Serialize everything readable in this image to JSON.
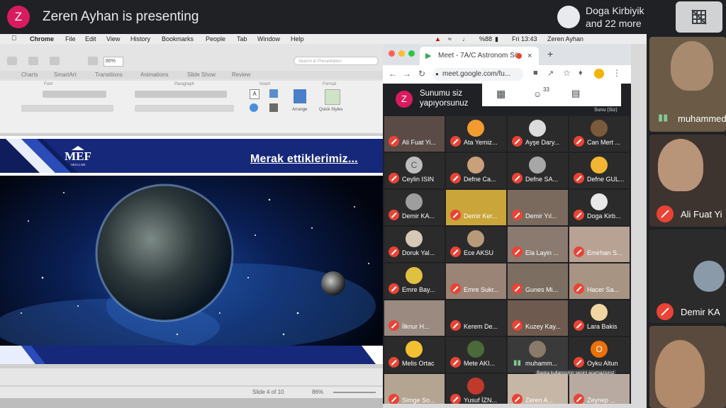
{
  "meet": {
    "presenter_initial": "Z",
    "presenter_banner": "Zeren Ayhan is presenting",
    "more_participants_line1": "Doga Kirbiyik",
    "more_participants_line2": "and 22 more"
  },
  "mac_menubar": {
    "items": [
      "Chrome",
      "File",
      "Edit",
      "View",
      "History",
      "Bookmarks",
      "People",
      "Tab",
      "Window",
      "Help"
    ],
    "battery": "%88",
    "clock": "Fri 13:43",
    "user": "Zeren Ayhan"
  },
  "ppt": {
    "tabs": [
      "Charts",
      "SmartArt",
      "Transitions",
      "Animations",
      "Slide Show",
      "Review"
    ],
    "ribbon_groups": [
      "Font",
      "Paragraph",
      "Insert",
      "Format"
    ],
    "zoom": "86%",
    "search_placeholder": "Search in Presentation",
    "arrange_label": "Arrange",
    "quick_styles_label": "Quick Styles",
    "slide_counter": "Slide 4 of 10",
    "status_zoom": "86%"
  },
  "slide": {
    "title": "Merak ettiklerimiz...",
    "logo_text": "MEF",
    "logo_sub": "OKULLARI"
  },
  "chrome": {
    "tab_title": "Meet - 7A/C Astronom Sö",
    "url": "meet.google.com/fu...",
    "self_initial": "Z",
    "self_banner_line1": "Sunumu siz",
    "self_banner_line2": "yapıyorsunuz",
    "participant_count": "33",
    "own_tile_label": "Sunu (Siz)"
  },
  "tiles": [
    {
      "name": "Ali Fuat Yi..."
    },
    {
      "name": "Ata Yemiz..."
    },
    {
      "name": "Ayşe Dary..."
    },
    {
      "name": "Can Mert ..."
    },
    {
      "name": "Ceylin ISIN"
    },
    {
      "name": "Defne Ca..."
    },
    {
      "name": "Defne SA..."
    },
    {
      "name": "Defne GUL..."
    },
    {
      "name": "Demir KA..."
    },
    {
      "name": "Demir Ker..."
    },
    {
      "name": "Demir Yıl..."
    },
    {
      "name": "Doga Kirb..."
    },
    {
      "name": "Doruk Yal..."
    },
    {
      "name": "Ece AKSU"
    },
    {
      "name": "Ela Layin ..."
    },
    {
      "name": "Emirhan S..."
    },
    {
      "name": "Emre Bay..."
    },
    {
      "name": "Emre Sukr..."
    },
    {
      "name": "Gunes Mi..."
    },
    {
      "name": "Hacer Sa..."
    },
    {
      "name": "İlknur H..."
    },
    {
      "name": "Kerem De..."
    },
    {
      "name": "Kuzey Kay..."
    },
    {
      "name": "Lara Bakis"
    },
    {
      "name": "Melis Ortac"
    },
    {
      "name": "Mete AKI..."
    },
    {
      "name": "muhamm..."
    },
    {
      "name": "Oyku Altun"
    },
    {
      "name": "Simge So..."
    },
    {
      "name": "Yusuf İZN..."
    },
    {
      "name": "Zeren A..."
    },
    {
      "name": "Zeynep ..."
    }
  ],
  "mute_tooltip": "Başka kullanıcının sesini açamazsınız",
  "oyku_initial": "O",
  "ceylin_initial": "C",
  "strip": {
    "p1": "muhammed",
    "p2": "Ali Fuat Yi",
    "p3": "Demir KA"
  },
  "colors": {
    "meet_bg": "#202124",
    "mute_red": "#ea4335",
    "presenter_pink": "#d81b60",
    "slide_navy": "#16287a"
  }
}
